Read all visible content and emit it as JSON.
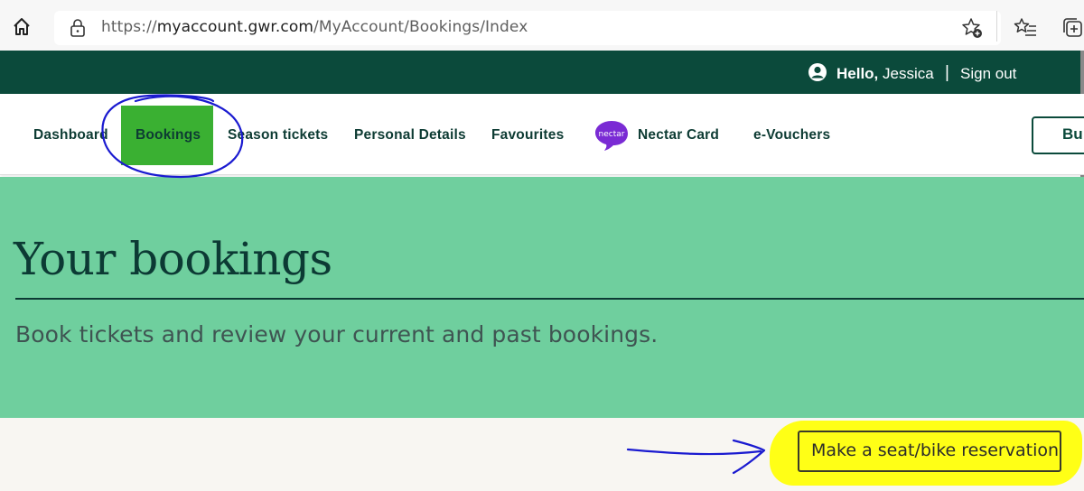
{
  "browser": {
    "url_prefix": "https://",
    "url_host": "myaccount.gwr.com",
    "url_path": "/MyAccount/Bookings/Index",
    "icons": [
      "home-icon",
      "lock-icon",
      "add-favorite-icon",
      "favorites-list-icon",
      "collections-icon"
    ]
  },
  "header": {
    "greeting": "Hello,",
    "user_name": "Jessica",
    "separator": "|",
    "sign_out": "Sign out"
  },
  "nav": {
    "items": [
      {
        "label": "Dashboard"
      },
      {
        "label": "Bookings",
        "active": true
      },
      {
        "label": "Season tickets"
      },
      {
        "label": "Personal Details"
      },
      {
        "label": "Favourites"
      },
      {
        "label": "Nectar Card",
        "logo_text": "nectar"
      },
      {
        "label": "e-Vouchers"
      }
    ],
    "cta_label": "Bu"
  },
  "hero": {
    "title": "Your bookings",
    "subtitle": "Book tickets and review your current and past bookings."
  },
  "actions": {
    "reservation_label": "Make a seat/bike reservation"
  },
  "colors": {
    "brand_dark": "#0b4a3b",
    "active_tab": "#3ab032",
    "hero_bg": "#6fcf9e",
    "highlight": "#ffff16",
    "annotation_ink": "#1a1ad0"
  }
}
